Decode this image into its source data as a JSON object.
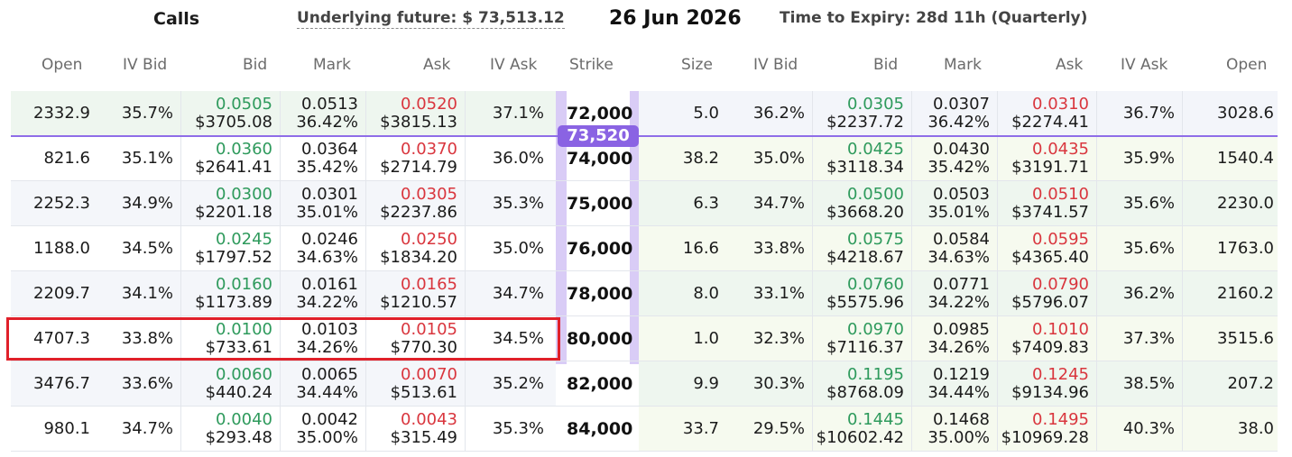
{
  "header": {
    "side_label": "Calls",
    "underlying_label": "Underlying future:",
    "underlying_value": "$ 73,513.12",
    "expiry_date": "26 Jun 2026",
    "time_to_expiry": "Time to Expiry: 28d 11h (Quarterly)"
  },
  "columns": {
    "calls": [
      "Open",
      "IV Bid",
      "Bid",
      "Mark",
      "Ask",
      "IV Ask"
    ],
    "strike": "Strike",
    "puts": [
      "Size",
      "IV Bid",
      "Bid",
      "Mark",
      "Ask",
      "IV Ask",
      "Open"
    ]
  },
  "underlying_marker": "73,520",
  "colors": {
    "bid": "#2e9a5c",
    "ask": "#d9363e",
    "accent": "#8a63e3",
    "highlight": "#e0202a"
  },
  "rows": [
    {
      "strike": "72,000",
      "call": {
        "open": "2332.9",
        "iv_bid": "35.7%",
        "bid": "0.0505",
        "bid_usd": "$3705.08",
        "mark": "0.0513",
        "mark_iv": "36.42%",
        "ask": "0.0520",
        "ask_usd": "$3815.13",
        "iv_ask": "37.1%"
      },
      "put": {
        "size": "5.0",
        "iv_bid": "36.2%",
        "bid": "0.0305",
        "bid_usd": "$2237.72",
        "mark": "0.0307",
        "mark_iv": "36.42%",
        "ask": "0.0310",
        "ask_usd": "$2274.41",
        "iv_ask": "36.7%",
        "open": "3028.6"
      }
    },
    {
      "strike": "74,000",
      "call": {
        "open": "821.6",
        "iv_bid": "35.1%",
        "bid": "0.0360",
        "bid_usd": "$2641.41",
        "mark": "0.0364",
        "mark_iv": "35.42%",
        "ask": "0.0370",
        "ask_usd": "$2714.79",
        "iv_ask": "36.0%"
      },
      "put": {
        "size": "38.2",
        "iv_bid": "35.0%",
        "bid": "0.0425",
        "bid_usd": "$3118.34",
        "mark": "0.0430",
        "mark_iv": "35.42%",
        "ask": "0.0435",
        "ask_usd": "$3191.71",
        "iv_ask": "35.9%",
        "open": "1540.4"
      }
    },
    {
      "strike": "75,000",
      "call": {
        "open": "2252.3",
        "iv_bid": "34.9%",
        "bid": "0.0300",
        "bid_usd": "$2201.18",
        "mark": "0.0301",
        "mark_iv": "35.01%",
        "ask": "0.0305",
        "ask_usd": "$2237.86",
        "iv_ask": "35.3%"
      },
      "put": {
        "size": "6.3",
        "iv_bid": "34.7%",
        "bid": "0.0500",
        "bid_usd": "$3668.20",
        "mark": "0.0503",
        "mark_iv": "35.01%",
        "ask": "0.0510",
        "ask_usd": "$3741.57",
        "iv_ask": "35.6%",
        "open": "2230.0"
      }
    },
    {
      "strike": "76,000",
      "call": {
        "open": "1188.0",
        "iv_bid": "34.5%",
        "bid": "0.0245",
        "bid_usd": "$1797.52",
        "mark": "0.0246",
        "mark_iv": "34.63%",
        "ask": "0.0250",
        "ask_usd": "$1834.20",
        "iv_ask": "35.0%"
      },
      "put": {
        "size": "16.6",
        "iv_bid": "33.8%",
        "bid": "0.0575",
        "bid_usd": "$4218.67",
        "mark": "0.0584",
        "mark_iv": "34.63%",
        "ask": "0.0595",
        "ask_usd": "$4365.40",
        "iv_ask": "35.6%",
        "open": "1763.0"
      }
    },
    {
      "strike": "78,000",
      "call": {
        "open": "2209.7",
        "iv_bid": "34.1%",
        "bid": "0.0160",
        "bid_usd": "$1173.89",
        "mark": "0.0161",
        "mark_iv": "34.22%",
        "ask": "0.0165",
        "ask_usd": "$1210.57",
        "iv_ask": "34.7%"
      },
      "put": {
        "size": "8.0",
        "iv_bid": "33.1%",
        "bid": "0.0760",
        "bid_usd": "$5575.96",
        "mark": "0.0771",
        "mark_iv": "34.22%",
        "ask": "0.0790",
        "ask_usd": "$5796.07",
        "iv_ask": "36.2%",
        "open": "2160.2"
      }
    },
    {
      "strike": "80,000",
      "call": {
        "open": "4707.3",
        "iv_bid": "33.8%",
        "bid": "0.0100",
        "bid_usd": "$733.61",
        "mark": "0.0103",
        "mark_iv": "34.26%",
        "ask": "0.0105",
        "ask_usd": "$770.30",
        "iv_ask": "34.5%"
      },
      "put": {
        "size": "1.0",
        "iv_bid": "32.3%",
        "bid": "0.0970",
        "bid_usd": "$7116.37",
        "mark": "0.0985",
        "mark_iv": "34.26%",
        "ask": "0.1010",
        "ask_usd": "$7409.83",
        "iv_ask": "37.3%",
        "open": "3515.6"
      }
    },
    {
      "strike": "82,000",
      "call": {
        "open": "3476.7",
        "iv_bid": "33.6%",
        "bid": "0.0060",
        "bid_usd": "$440.24",
        "mark": "0.0065",
        "mark_iv": "34.44%",
        "ask": "0.0070",
        "ask_usd": "$513.61",
        "iv_ask": "35.2%"
      },
      "put": {
        "size": "9.9",
        "iv_bid": "30.3%",
        "bid": "0.1195",
        "bid_usd": "$8768.09",
        "mark": "0.1219",
        "mark_iv": "34.44%",
        "ask": "0.1245",
        "ask_usd": "$9134.96",
        "iv_ask": "38.5%",
        "open": "207.2"
      }
    },
    {
      "strike": "84,000",
      "call": {
        "open": "980.1",
        "iv_bid": "34.7%",
        "bid": "0.0040",
        "bid_usd": "$293.48",
        "mark": "0.0042",
        "mark_iv": "35.00%",
        "ask": "0.0043",
        "ask_usd": "$315.49",
        "iv_ask": "35.3%"
      },
      "put": {
        "size": "33.7",
        "iv_bid": "29.5%",
        "bid": "0.1445",
        "bid_usd": "$10602.42",
        "mark": "0.1468",
        "mark_iv": "35.00%",
        "ask": "0.1495",
        "ask_usd": "$10969.28",
        "iv_ask": "40.3%",
        "open": "38.0"
      }
    }
  ]
}
